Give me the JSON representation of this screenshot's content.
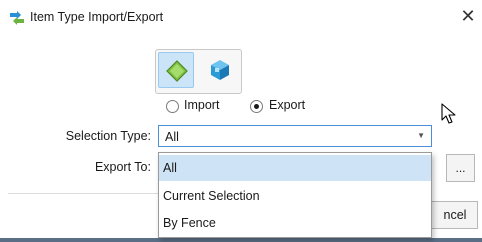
{
  "window": {
    "title": "Item Type Import/Export",
    "close_glyph": "✕"
  },
  "item_type_buttons": [
    {
      "icon": "diamond-item-icon",
      "selected": true
    },
    {
      "icon": "cube-library-icon",
      "selected": false
    }
  ],
  "mode": {
    "options": [
      "Import",
      "Export"
    ],
    "selected": "Export"
  },
  "selection_type": {
    "label": "Selection Type:",
    "value": "All",
    "options": [
      "All",
      "Current Selection",
      "By Fence"
    ],
    "highlighted": "All"
  },
  "export_to": {
    "label": "Export To:",
    "value": "",
    "browse_label": "..."
  },
  "footer": {
    "cancel_label_visible": "ncel"
  },
  "colors": {
    "accent": "#4a90d9",
    "selected_bg": "#cfe3f7",
    "diamond": "#7cc243",
    "cube": "#2b9bd6"
  }
}
